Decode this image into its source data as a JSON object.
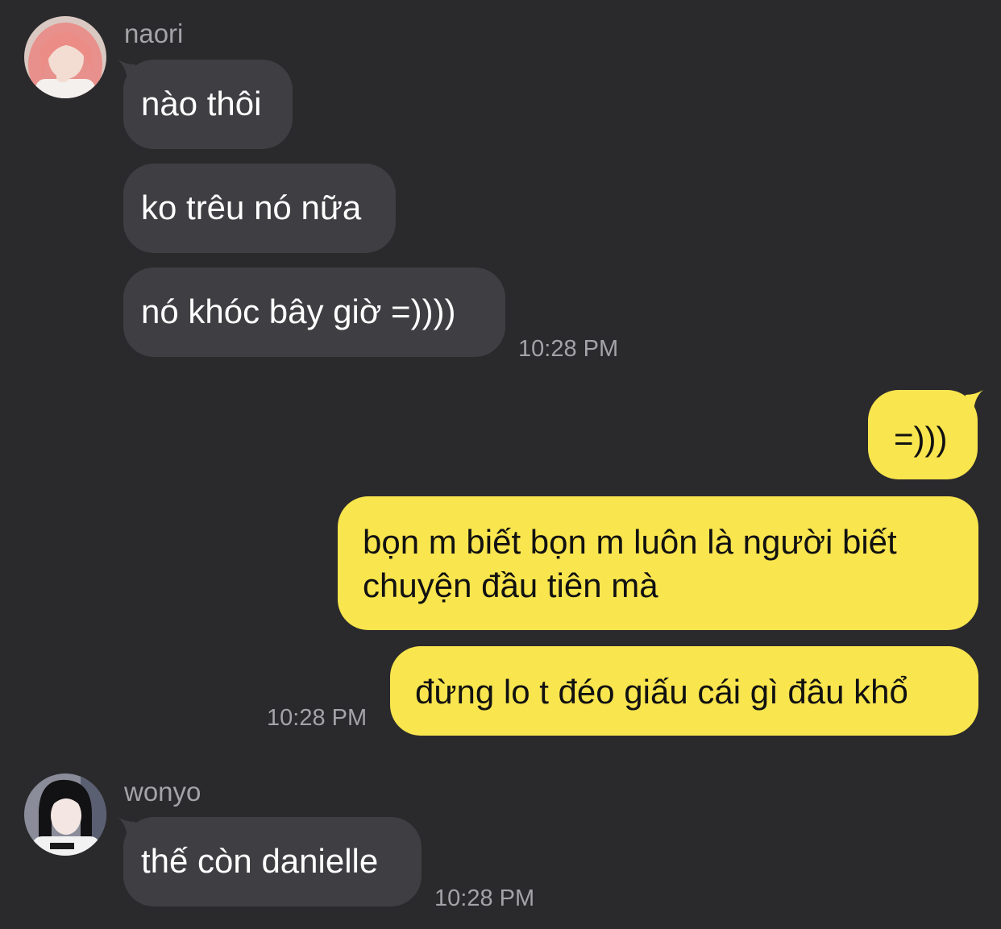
{
  "colors": {
    "background": "#2a2a2c",
    "incoming_bubble": "#3f3f43",
    "outgoing_bubble": "#f9e54e",
    "timestamp": "#a3a3a8"
  },
  "messages": {
    "group1": {
      "sender": "naori",
      "avatar_icon": "profile-photo-icon",
      "bubbles": [
        "nào thôi",
        "ko trêu nó nữa",
        "nó khóc bây giờ =))))"
      ],
      "time": "10:28 PM"
    },
    "outgoing": {
      "bubbles": [
        "=)))",
        "bọn m biết bọn m luôn là người biết",
        "chuyện đầu tiên mà",
        "đừng lo t đéo giấu cái gì đâu khổ"
      ],
      "time": "10:28 PM"
    },
    "group2": {
      "sender": "wonyo",
      "avatar_icon": "profile-photo-icon",
      "bubbles": [
        "thế còn danielle"
      ],
      "time": "10:28 PM"
    }
  }
}
